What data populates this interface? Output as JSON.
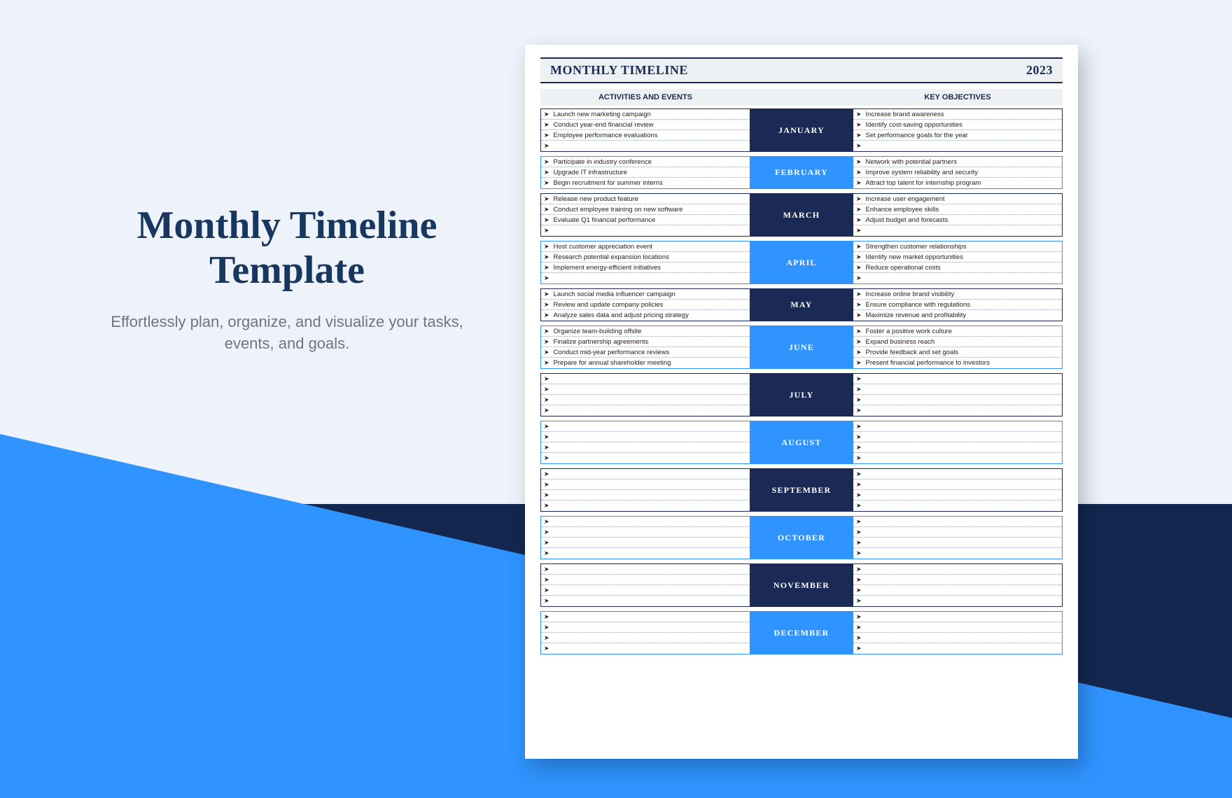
{
  "left": {
    "title_l1": "Monthly Timeline",
    "title_l2": "Template",
    "sub": "Effortlessly plan, organize, and visualize your tasks, events, and goals."
  },
  "doc": {
    "title": "MONTHLY TIMELINE",
    "year": "2023",
    "col_left": "ACTIVITIES AND EVENTS",
    "col_right": "KEY OBJECTIVES"
  },
  "months": [
    {
      "name": "JANUARY",
      "dark": true,
      "acts": [
        "Launch new marketing campaign",
        "Conduct year-end financial review",
        "Employee performance evaluations",
        ""
      ],
      "objs": [
        "Increase brand awareness",
        "Identify cost-saving opportunities",
        "Set performance goals for the year",
        ""
      ]
    },
    {
      "name": "FEBRUARY",
      "dark": false,
      "acts": [
        "Participate in industry conference",
        "Upgrade IT infrastructure",
        "Begin recruitment for summer interns"
      ],
      "objs": [
        "Network with potential partners",
        "Improve system reliability and security",
        "Attract top talent for internship program"
      ]
    },
    {
      "name": "MARCH",
      "dark": true,
      "acts": [
        "Release new product feature",
        "Conduct employee training on new software",
        "Evaluate Q1 financial performance",
        ""
      ],
      "objs": [
        "Increase user engagement",
        "Enhance employee skills",
        "Adjust budget and forecasts",
        ""
      ]
    },
    {
      "name": "APRIL",
      "dark": false,
      "acts": [
        "Host customer appreciation event",
        "Research potential expansion locations",
        "Implement energy-efficient initiatives",
        ""
      ],
      "objs": [
        "Strengthen customer relationships",
        "Identify new market opportunities",
        "Reduce operational costs",
        ""
      ]
    },
    {
      "name": "MAY",
      "dark": true,
      "acts": [
        "Launch social media influencer campaign",
        "Review and update company policies",
        "Analyze sales data and adjust pricing strategy"
      ],
      "objs": [
        "Increase online brand visibility",
        "Ensure compliance with regulations",
        "Maximize revenue and profitability"
      ]
    },
    {
      "name": "JUNE",
      "dark": false,
      "acts": [
        "Organize team-building offsite",
        "Finalize partnership agreements",
        "Conduct mid-year performance reviews",
        "Prepare for annual shareholder meeting"
      ],
      "objs": [
        "Foster a positive work culture",
        "Expand business reach",
        "Provide feedback and set goals",
        "Present financial performance to investors"
      ]
    },
    {
      "name": "JULY",
      "dark": true,
      "acts": [
        "",
        "",
        "",
        ""
      ],
      "objs": [
        "",
        "",
        "",
        ""
      ]
    },
    {
      "name": "AUGUST",
      "dark": false,
      "acts": [
        "",
        "",
        "",
        ""
      ],
      "objs": [
        "",
        "",
        "",
        ""
      ]
    },
    {
      "name": "SEPTEMBER",
      "dark": true,
      "acts": [
        "",
        "",
        "",
        ""
      ],
      "objs": [
        "",
        "",
        "",
        ""
      ]
    },
    {
      "name": "OCTOBER",
      "dark": false,
      "acts": [
        "",
        "",
        "",
        ""
      ],
      "objs": [
        "",
        "",
        "",
        ""
      ]
    },
    {
      "name": "NOVEMBER",
      "dark": true,
      "acts": [
        "",
        "",
        "",
        ""
      ],
      "objs": [
        "",
        "",
        "",
        ""
      ]
    },
    {
      "name": "DECEMBER",
      "dark": false,
      "acts": [
        "",
        "",
        "",
        ""
      ],
      "objs": [
        "",
        "",
        "",
        ""
      ]
    }
  ]
}
